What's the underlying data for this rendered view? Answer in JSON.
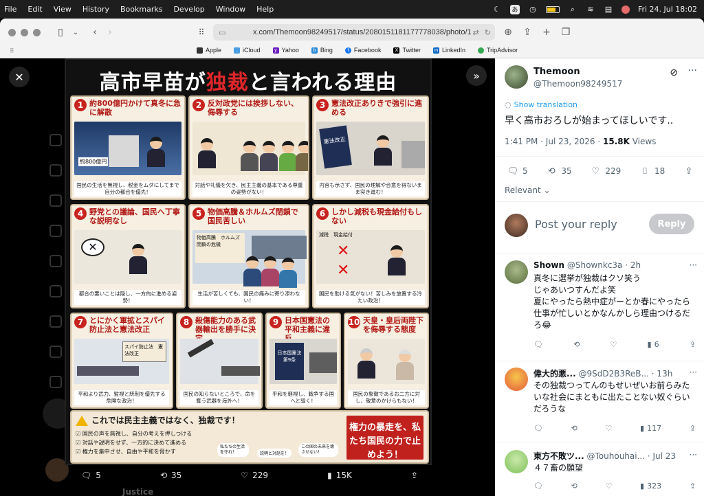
{
  "menubar": {
    "items": [
      "File",
      "Edit",
      "View",
      "History",
      "Bookmarks",
      "Develop",
      "Window",
      "Help"
    ],
    "input_label": "あ",
    "clock": "Fri 24. Jul  18:02"
  },
  "browser": {
    "url": "x.com/Themoon98249517/status/2080151181177778038/photo/1",
    "favorites": [
      "Apple",
      "iCloud",
      "Yahoo",
      "Bing",
      "Facebook",
      "Twitter",
      "LinkedIn",
      "TripAdvisor"
    ]
  },
  "poster": {
    "title_a": "高市早苗が",
    "title_red": "独裁",
    "title_b": "と言われる理由",
    "panels": [
      {
        "num": "1",
        "head": "約800億円かけて真冬に急に解散",
        "art_label": "約800億円",
        "caption": "国民の生活を無視し、税金をムダにしてまで自分の都合を優先！"
      },
      {
        "num": "2",
        "head": "反対政党には挨拶しない、侮辱する",
        "art_label": "",
        "caption": "対話や礼儀を欠き、民主主義の基本である尊重の姿勢がない！"
      },
      {
        "num": "3",
        "head": "憲法改正ありきで強引に進める",
        "art_label": "憲法改正",
        "caption": "内容も示さず、国民の理解や合意を得ないまま突き進む！"
      },
      {
        "num": "4",
        "head": "野党との議論、国民へ丁寧な説明なし",
        "art_label": "",
        "caption": "都合の悪いことは隠し、一方的に進める姿勢！"
      },
      {
        "num": "5",
        "head": "物価高騰＆ホルムズ閉鎖で国民苦しい",
        "art_label": "物価高騰　ホルムズ閉鎖の危機",
        "caption": "生活が苦しくても、国民の痛みに寄り添わない！"
      },
      {
        "num": "6",
        "head": "しかし減税も現金給付もしない",
        "art_label": "減税　現金給付",
        "caption": "国民を助ける気がない！苦しみを放置する冷たい政治！"
      },
      {
        "num": "7",
        "head": "とにかく軍拡とスパイ防止法と憲法改正",
        "art_label": "スパイ防止法　憲法改正",
        "caption": "平和より武力、監視と統制を優先する危険な政治！"
      },
      {
        "num": "8",
        "head": "殺傷能力のある武器輸出を勝手に決定",
        "art_label": "",
        "caption": "国民の知らないところで、命を奪う武器を海外へ！"
      },
      {
        "num": "9",
        "head": "日本国憲法の平和主義に違反",
        "art_label": "日本国憲法 第9条",
        "caption": "平和を軽視し、戦争する国へと導く！"
      },
      {
        "num": "10",
        "head": "天皇・皇后両陛下を侮辱する態度",
        "art_label": "",
        "caption": "国民の象徴であるお二方に対し、敬意のかけらもない！"
      }
    ],
    "banner_warn": "これでは民主主義ではなく、独裁です！",
    "banner_list": [
      "国民の声を無視し、自分の考えを押しつける",
      "対話や説明をせず、一方的に決めて進める",
      "権力を集中させ、自由や平和を脅かす"
    ],
    "banner_bubbles": [
      "私たちの生活を守れ！",
      "説明と対話を！",
      "この国の未来を壊させない！"
    ],
    "banner_red": "権力の暴走を、私たち国民の力で止めよう！"
  },
  "media_actions": {
    "replies": "5",
    "reposts": "35",
    "likes": "229",
    "views": "15K"
  },
  "media_behind_text": "Justice",
  "tweet": {
    "name": "Themoon",
    "handle": "@Themoon98249517",
    "translate": "Show translation",
    "text": "早く高市おろしが始まってほしいです..",
    "time": "1:41 PM · Jul 23, 2026 · ",
    "views_count": "15.8K",
    "views_label": " Views",
    "replies": "5",
    "reposts": "35",
    "likes": "229",
    "bookmarks": "18",
    "sort": "Relevant"
  },
  "compose": {
    "placeholder": "Post your reply",
    "button": "Reply"
  },
  "replies": [
    {
      "name": "Shown",
      "handle": "@Shownkc3a · 2h",
      "text": "真冬に選挙が独裁はクソ笑う\nじゃあいつすんだよ笑\n夏にやったら熱中症がーとか春にやったら仕事が忙しいとかなんかしら理由つけるだろ😂",
      "views": "6",
      "color": "#7a8f5a"
    },
    {
      "name": "偉大的悪...",
      "handle": "@9SdD2B3ReB... · 13h",
      "text": "その独裁つってんのもせいぜいお前らみたいな社会にまともに出たことない奴ぐらいだろうな",
      "views": "117",
      "color": "#e45b3c"
    },
    {
      "name": "東方不敗ツ...",
      "handle": "@Touhouhai... · Jul 23",
      "text": "４７畜の願望",
      "views": "323",
      "color": "#9ed27a"
    }
  ]
}
